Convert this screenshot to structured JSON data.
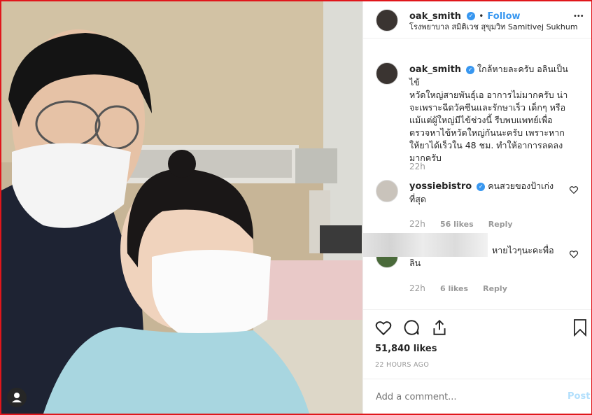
{
  "post": {
    "author": "oak_smith",
    "follow_label": "Follow",
    "location": "โรงพยาบาล สมิติเวช สุขุมวิท Samitivej Sukhumvit",
    "more_label": "•••",
    "caption_lines": [
      "ใกล้หายละครับ อลินเป็นไข้",
      "หวัดใหญ่สายพันธุ์เอ อาการไม่มากครับ น่า",
      "จะเพราะฉีดวัคซีนและรักษาเร็ว เด็กๆ หรือ",
      "แม้แต่ผู้ใหญ่มีไข้ช่วงนี้ รีบพบแพทย์เพื่อ",
      "ตรวจหาไข้หวัดใหญ่กันนะครับ เพราะหาก",
      "ให้ยาได้เร็วใน 48 ชม. ทำให้อาการลดลง",
      "มากครับ"
    ],
    "caption_time": "22h",
    "likes": "51,840 likes",
    "posted_ago": "22 HOURS AGO",
    "comment_placeholder": "Add a comment...",
    "post_label": "Post"
  },
  "comments": [
    {
      "user": "yossiebistro",
      "verified": true,
      "lines": [
        "คนสวยของป้าเก่ง",
        "ที่สุด"
      ],
      "time": "22h",
      "likes": "56 likes",
      "reply": "Reply"
    },
    {
      "user": "",
      "verified": false,
      "lines": [
        "หายไวๆนะคะพื่อ",
        "ลิน"
      ],
      "time": "22h",
      "likes": "6 likes",
      "reply": "Reply"
    }
  ],
  "icons": [
    "heart-icon",
    "comment-icon",
    "share-icon",
    "bookmark-icon",
    "user-tag-icon"
  ],
  "colors": {
    "accent": "#3897f0",
    "border": "#e0161b",
    "text": "#262626",
    "muted": "#999999"
  }
}
